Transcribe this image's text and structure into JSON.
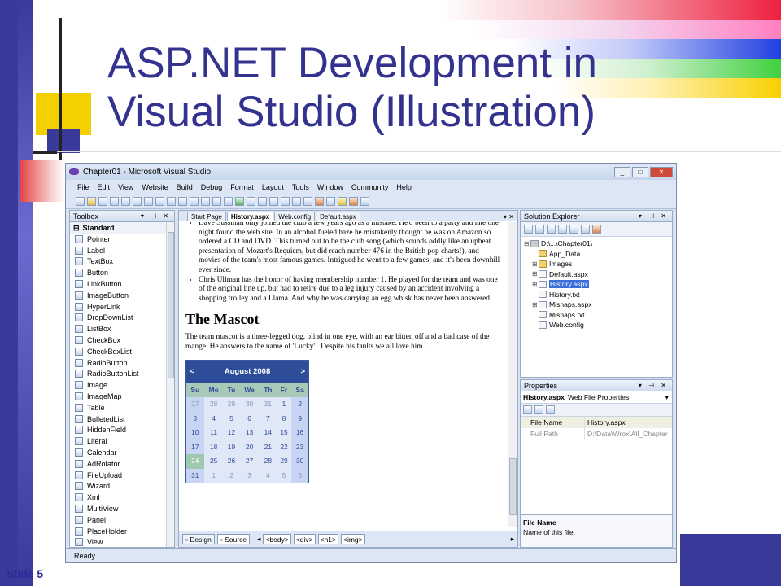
{
  "slide": {
    "title_line1": "ASP.NET Development in",
    "title_line2": "Visual Studio (Illustration)",
    "number": "Slide 5"
  },
  "window": {
    "title": "Chapter01 - Microsoft Visual Studio",
    "status": "Ready"
  },
  "menu": [
    "File",
    "Edit",
    "View",
    "Website",
    "Build",
    "Debug",
    "Format",
    "Layout",
    "Tools",
    "Window",
    "Community",
    "Help"
  ],
  "toolbox": {
    "title": "Toolbox",
    "category": "Standard",
    "items": [
      "Pointer",
      "Label",
      "TextBox",
      "Button",
      "LinkButton",
      "ImageButton",
      "HyperLink",
      "DropDownList",
      "ListBox",
      "CheckBox",
      "CheckBoxList",
      "RadioButton",
      "RadioButtonList",
      "Image",
      "ImageMap",
      "Table",
      "BulletedList",
      "HiddenField",
      "Literal",
      "Calendar",
      "AdRotator",
      "FileUpload",
      "Wizard",
      "Xml",
      "MultiView",
      "Panel",
      "PlaceHolder",
      "View"
    ]
  },
  "editor": {
    "tabs": [
      "Start Page",
      "History.aspx",
      "Web.config",
      "Default.aspx"
    ],
    "bullets": [
      "Dave Sussman only joined the club a few years ago as a mistake. He'd been to a party and late one night found the web site. In an alcohol fueled haze he mistakenly thought he was on Amazon so ordered a CD and DVD. This turned out to be the club song (which sounds oddly like an upbeat presentation of Mozart's Requiem, but did reach number 476 in the British pop charts!), and movies of the team's most famous games. Intrigued he went to a few games, and it's been downhill ever since.",
      "Chris Ullman has the honor of having membership number 1. He played for the team and was one of the original line up, but had to retire due to a leg injury caused by an accident involving a shopping trolley and a Llama. And why he was carrying an egg whisk has never been answered."
    ],
    "heading": "The Mascot",
    "paragraph": "The team mascot is a three-legged dog, blind in one eye, with an ear bitten off and a bad case of the mange. He answers to the name of 'Lucky' . Despite his faults we all love him.",
    "calendar": {
      "month": "August 2008",
      "prev": "<",
      "next": ">",
      "days": [
        "Su",
        "Mo",
        "Tu",
        "We",
        "Th",
        "Fr",
        "Sa"
      ],
      "weeks": [
        [
          "27",
          "28",
          "29",
          "30",
          "31",
          "1",
          "2"
        ],
        [
          "3",
          "4",
          "5",
          "6",
          "7",
          "8",
          "9"
        ],
        [
          "10",
          "11",
          "12",
          "13",
          "14",
          "15",
          "16"
        ],
        [
          "17",
          "18",
          "19",
          "20",
          "21",
          "22",
          "23"
        ],
        [
          "24",
          "25",
          "26",
          "27",
          "28",
          "29",
          "30"
        ],
        [
          "31",
          "1",
          "2",
          "3",
          "4",
          "5",
          "6"
        ]
      ]
    },
    "design_label": "Design",
    "source_label": "Source",
    "breadcrumbs": [
      "<body>",
      "<div>",
      "<h1>",
      "<img>"
    ]
  },
  "solution_explorer": {
    "title": "Solution Explorer",
    "nodes": [
      {
        "label": "D:\\...\\Chapter01\\",
        "kind": "proj",
        "indent": 0,
        "exp": "⊟"
      },
      {
        "label": "App_Data",
        "kind": "folder",
        "indent": 1,
        "exp": ""
      },
      {
        "label": "Images",
        "kind": "folder",
        "indent": 1,
        "exp": "⊞"
      },
      {
        "label": "Default.aspx",
        "kind": "file",
        "indent": 1,
        "exp": "⊞"
      },
      {
        "label": "History.aspx",
        "kind": "file",
        "indent": 1,
        "exp": "⊞",
        "selected": true
      },
      {
        "label": "History.txt",
        "kind": "file",
        "indent": 1,
        "exp": ""
      },
      {
        "label": "Mishaps.aspx",
        "kind": "file",
        "indent": 1,
        "exp": "⊞"
      },
      {
        "label": "Mishaps.txt",
        "kind": "file",
        "indent": 1,
        "exp": ""
      },
      {
        "label": "Web.config",
        "kind": "file",
        "indent": 1,
        "exp": ""
      }
    ]
  },
  "properties": {
    "title": "Properties",
    "object_name": "History.aspx",
    "object_type": "Web File Properties",
    "rows": [
      {
        "key": "File Name",
        "value": "History.aspx"
      },
      {
        "key": "Full Path",
        "value": "D:\\Data\\Wrox\\All_Chapter"
      }
    ],
    "desc_title": "File Name",
    "desc_text": "Name of this file."
  }
}
